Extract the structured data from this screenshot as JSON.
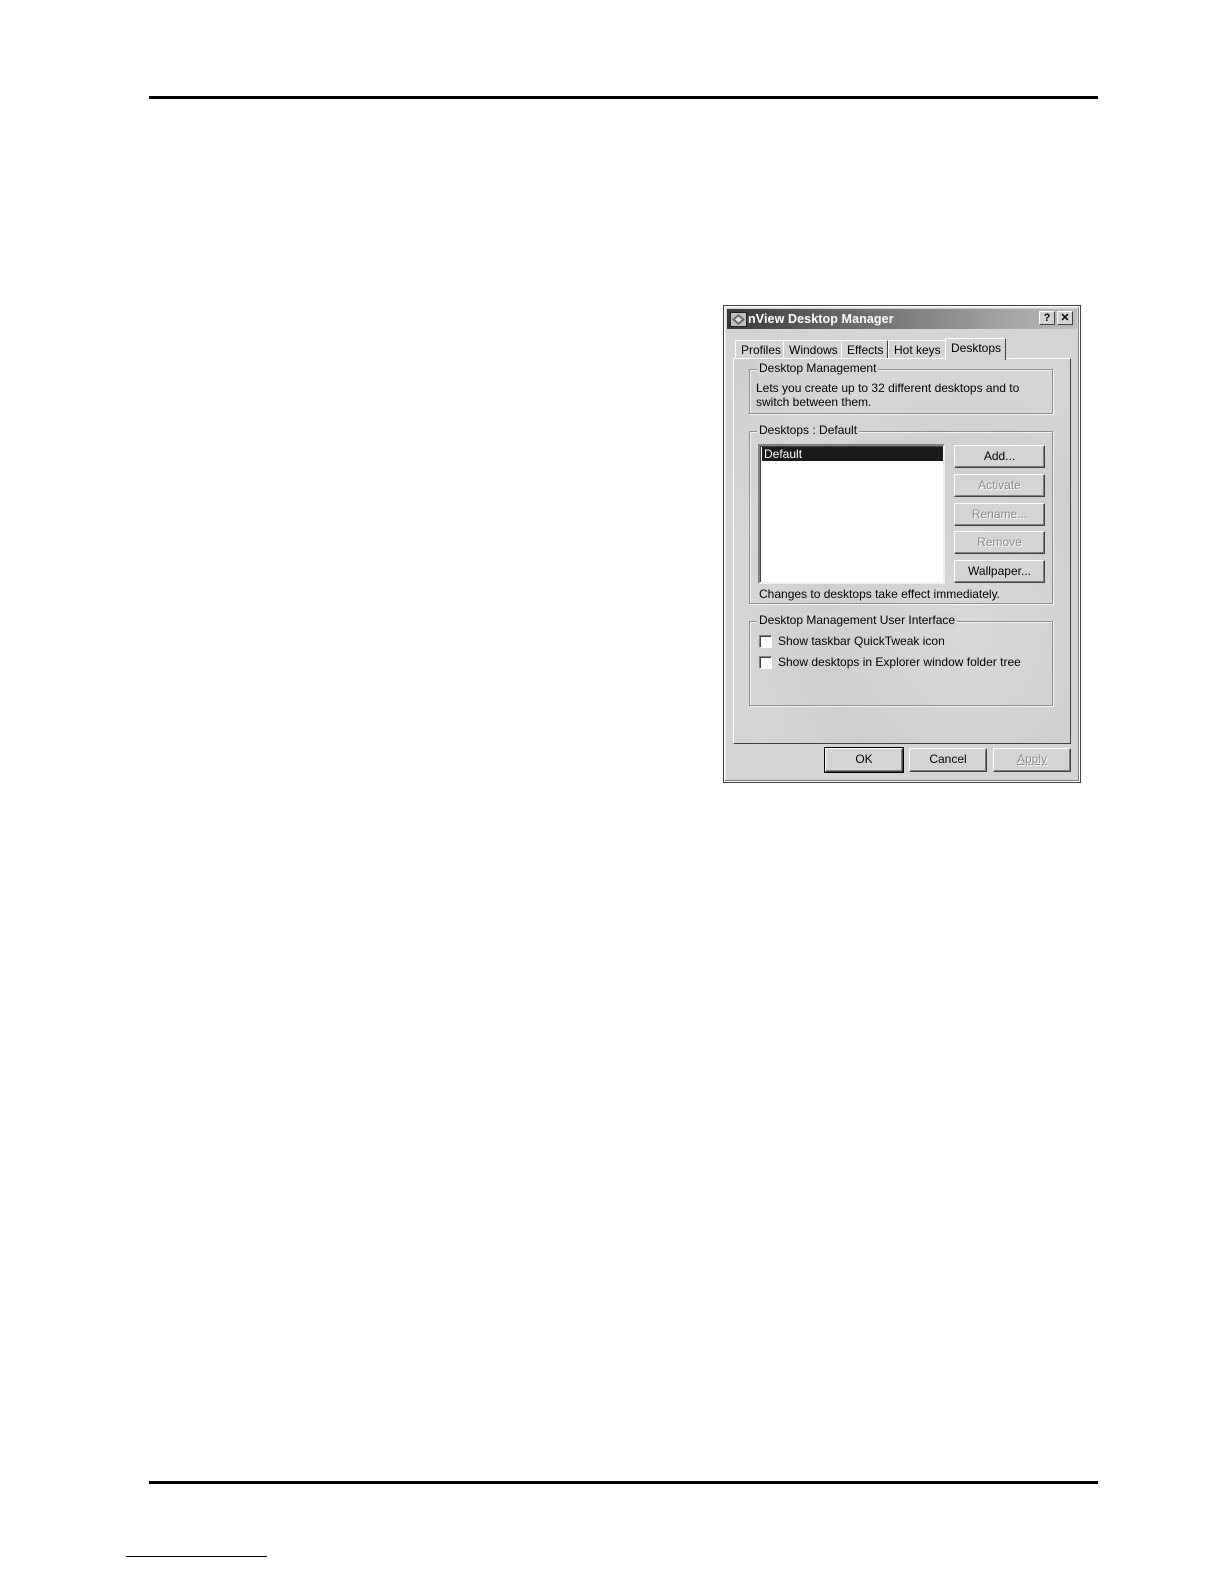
{
  "dialog": {
    "title": "nView Desktop Manager",
    "help_label": "?",
    "close_label": "✕",
    "tabs": [
      {
        "label": "Profiles"
      },
      {
        "label": "Windows"
      },
      {
        "label": "Effects"
      },
      {
        "label": "Hot keys"
      },
      {
        "label": "Desktops",
        "active": true
      }
    ],
    "desktop_management": {
      "legend": "Desktop Management",
      "description": "Lets you create up to 32 different desktops and to switch between them."
    },
    "desktops_group": {
      "legend": "Desktops : Default",
      "list_items": [
        "Default"
      ],
      "buttons": {
        "add": "Add...",
        "activate": "Activate",
        "rename": "Rename...",
        "remove": "Remove",
        "wallpaper": "Wallpaper..."
      },
      "note": "Changes to desktops take effect immediately."
    },
    "ui_group": {
      "legend": "Desktop Management User Interface",
      "options": [
        {
          "label": "Show taskbar QuickTweak icon",
          "checked": false
        },
        {
          "label": "Show desktops in Explorer window folder tree",
          "checked": false
        }
      ]
    },
    "footer": {
      "ok": "OK",
      "cancel": "Cancel",
      "apply": "Apply"
    }
  }
}
